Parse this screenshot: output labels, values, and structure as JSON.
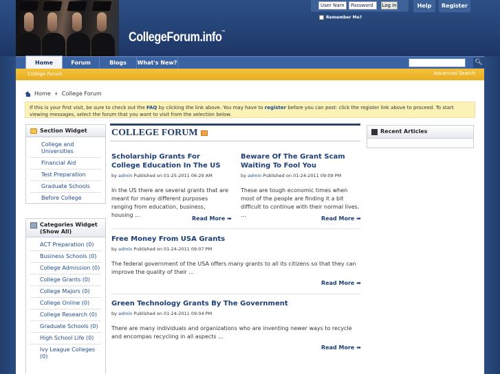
{
  "header": {
    "logo_text": "CollegeForum.info",
    "logo_tm": "™",
    "username_placeholder": "User Name",
    "password_placeholder": "Password",
    "login_label": "Log in",
    "remember_label": "Remember Me?",
    "help_label": "Help",
    "register_label": "Register"
  },
  "nav": {
    "tabs": [
      "Home",
      "Forum",
      "Blogs",
      "What's New?"
    ],
    "sub_left": "College Forum",
    "sub_right": "Advanced Search"
  },
  "breadcrumb": {
    "home": "Home",
    "current": "College Forum"
  },
  "notice": {
    "part1": "If this is your first visit, be sure to check out the ",
    "faq": "FAQ",
    "part2": " by clicking the link above. You may have to ",
    "register": "register",
    "part3": " before you can post: click the register link above to proceed. To start viewing messages, select the forum that you want to visit from the selection below."
  },
  "section_widget": {
    "title": "Section Widget",
    "items": [
      "College and Universities",
      "Financial Aid",
      "Test Preparation",
      "Graduate Schools",
      "Before College"
    ]
  },
  "categories_widget": {
    "title": "Categories Widget (Show All)",
    "items": [
      "ACT Preparation (0)",
      "Business Schools (0)",
      "College Admission (0)",
      "College Grants (0)",
      "College Majors (0)",
      "College Online (0)",
      "College Research (0)",
      "Graduate Schools (0)",
      "High School Life (0)",
      "Ivy League Colleges (0)"
    ]
  },
  "center": {
    "title": "COLLEGE FORUM",
    "read_more": "Read More ➡",
    "posts": [
      {
        "title": "Scholarship Grants For College Education In The US",
        "by": "by ",
        "author": "admin",
        "published": " Published on 01-25-2011 06:29 AM",
        "excerpt": "In the US there are several grants that are meant for many different purposes ranging from education, business, housing ..."
      },
      {
        "title": "Beware Of The Grant Scam Waiting To Fool You",
        "by": "by ",
        "author": "admin",
        "published": " Published on 01-24-2011 09:09 PM",
        "excerpt": "These are tough economic times when most of the people are finding it a bit difficult to continue with their normal lives. ..."
      },
      {
        "title": "Free Money From USA Grants",
        "by": "by ",
        "author": "admin",
        "published": " Published on 01-24-2011 09:07 PM",
        "excerpt": "The federal government of the USA offers many grants to all its citizens so that they can improve the quality of their ..."
      },
      {
        "title": "Green Technology Grants By The Government",
        "by": "by ",
        "author": "admin",
        "published": " Published on 01-24-2011 09:04 PM",
        "excerpt": "There are many individuals and organizations who are inventing newer ways to recycle and encompas recycling in all aspects ..."
      }
    ]
  },
  "recent_articles": {
    "title": "Recent Articles"
  }
}
